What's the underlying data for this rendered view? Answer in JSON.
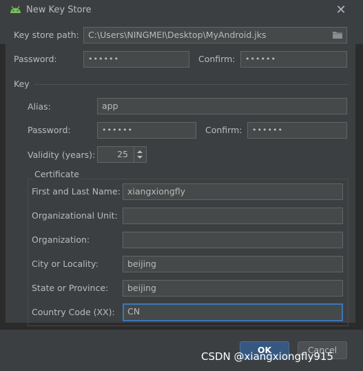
{
  "window": {
    "title": "New Key Store",
    "close_icon": "close-icon",
    "app_icon": "android-icon"
  },
  "keystore": {
    "path_label": "Key store path:",
    "path_value": "C:\\Users\\NINGMEI\\Desktop\\MyAndroid.jks",
    "password_label": "Password:",
    "password_value": "••••••",
    "confirm_label": "Confirm:",
    "confirm_value": "••••••"
  },
  "key": {
    "section_label": "Key",
    "alias_label": "Alias:",
    "alias_value": "app",
    "password_label": "Password:",
    "password_value": "••••••",
    "confirm_label": "Confirm:",
    "confirm_value": "••••••",
    "validity_label": "Validity (years):",
    "validity_value": "25"
  },
  "certificate": {
    "section_label": "Certificate",
    "fields": [
      {
        "label": "First and Last Name:",
        "value": "xiangxiongfly"
      },
      {
        "label": "Organizational Unit:",
        "value": ""
      },
      {
        "label": "Organization:",
        "value": ""
      },
      {
        "label": "City or Locality:",
        "value": "beijing"
      },
      {
        "label": "State or Province:",
        "value": "beijing"
      },
      {
        "label": "Country Code (XX):",
        "value": "CN"
      }
    ]
  },
  "buttons": {
    "ok": "OK",
    "cancel": "Cancel"
  },
  "watermark": "CSDN @xiangxiongfly915",
  "colors": {
    "background": "#3c3f41",
    "field": "#45494a",
    "focus": "#3d77b9",
    "primary": "#365880"
  }
}
